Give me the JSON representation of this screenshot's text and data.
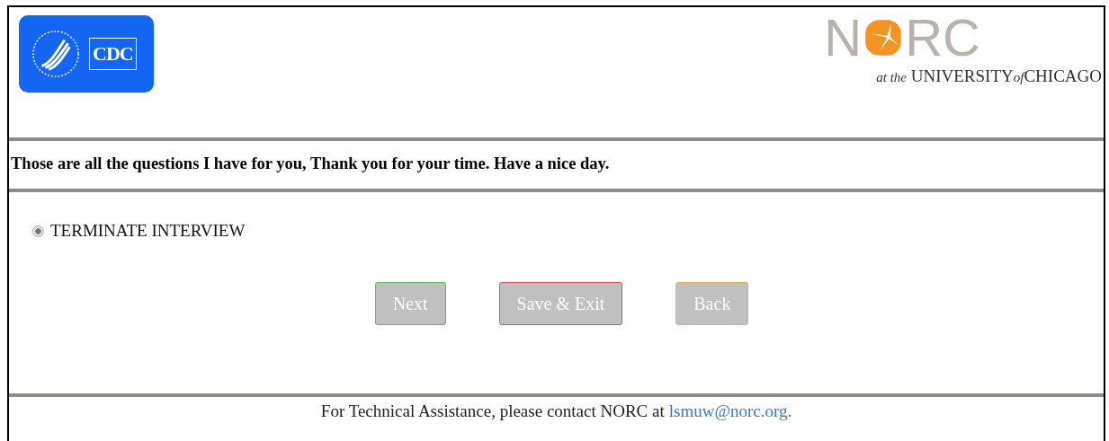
{
  "header": {
    "left_logo": {
      "text": "CDC"
    },
    "right_logo": {
      "wordmark_start": "N",
      "wordmark_end": "RC",
      "tagline_a": "at the",
      "tagline_b": "UNIVERSITY",
      "tagline_c": "of",
      "tagline_d": "CHICAGO"
    }
  },
  "message": "Those are all the questions I have for you, Thank you for your time. Have a nice day.",
  "options": [
    {
      "label": "TERMINATE INTERVIEW",
      "selected": true,
      "disabled": true
    }
  ],
  "buttons": [
    {
      "label": "Next",
      "color": "#5cb85c",
      "disabled": true
    },
    {
      "label": "Save & Exit",
      "color": "#d9534f",
      "disabled": true
    },
    {
      "label": "Back",
      "color": "#f0ad4e",
      "disabled": true
    }
  ],
  "footer": {
    "text": "For Technical Assistance, please contact NORC at",
    "link": "lsmuw@norc.org."
  }
}
